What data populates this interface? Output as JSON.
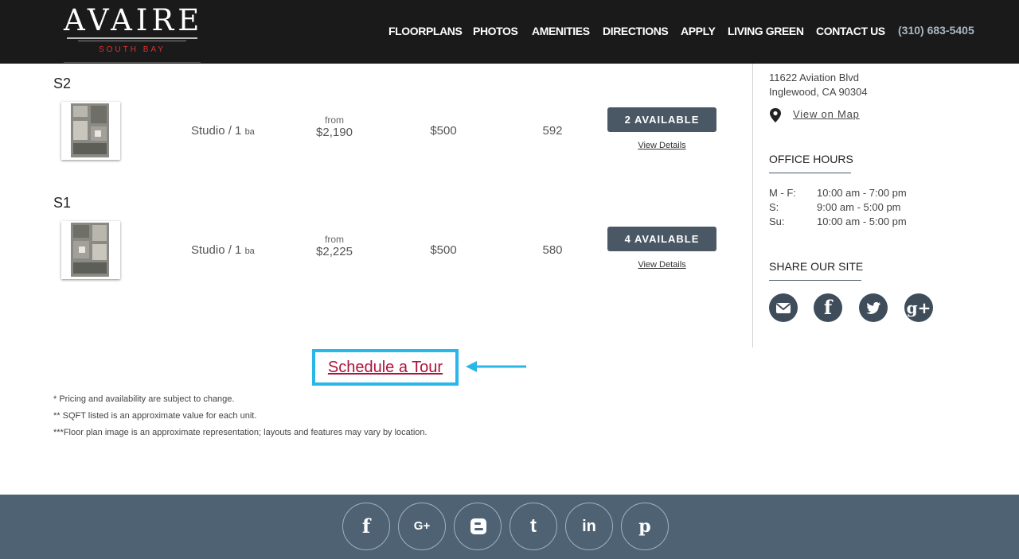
{
  "brand": {
    "name": "AVAIRE",
    "tagline": "SOUTH BAY"
  },
  "nav": {
    "items": [
      {
        "label": "FLOORPLANS"
      },
      {
        "label": "PHOTOS"
      },
      {
        "label": "AMENITIES"
      },
      {
        "label": "DIRECTIONS"
      },
      {
        "label": "APPLY"
      },
      {
        "label": "LIVING GREEN"
      },
      {
        "label": "CONTACT US"
      }
    ],
    "phone": "(310) 683-5405"
  },
  "floorplans": [
    {
      "name": "S2",
      "type_main": "Studio / 1",
      "type_small": "ba",
      "from_label": "from",
      "price": "$2,190",
      "deposit": "$500",
      "sqft": "592",
      "availability": "2 AVAILABLE",
      "details_label": "View Details"
    },
    {
      "name": "S1",
      "type_main": "Studio / 1",
      "type_small": "ba",
      "from_label": "from",
      "price": "$2,225",
      "deposit": "$500",
      "sqft": "580",
      "availability": "4 AVAILABLE",
      "details_label": "View Details"
    }
  ],
  "sidebar": {
    "address_line1": "11622 Aviation Blvd",
    "address_line2": "Inglewood, CA 90304",
    "map_link": "View on Map",
    "office_hours_title": "OFFICE HOURS",
    "hours": [
      {
        "day": "M - F:",
        "time": "10:00 am - 7:00 pm"
      },
      {
        "day": "S:",
        "time": "9:00 am - 5:00 pm"
      },
      {
        "day": "Su:",
        "time": "10:00 am - 5:00 pm"
      }
    ],
    "share_title": "SHARE OUR SITE",
    "share_icons": [
      "email-icon",
      "facebook-icon",
      "twitter-icon",
      "google-plus-icon"
    ]
  },
  "schedule": {
    "label": "Schedule a Tour",
    "highlight_color": "#29b6e8",
    "link_color": "#b0123a"
  },
  "notes": [
    "* Pricing and availability are subject to change.",
    "** SQFT listed is an approximate value for each unit.",
    "***Floor plan image is an approximate representation; layouts and features may vary by location."
  ],
  "footer": {
    "social_icons": [
      "facebook-icon",
      "google-plus-icon",
      "blogger-icon",
      "tumblr-icon",
      "linkedin-icon",
      "pinterest-icon"
    ]
  },
  "colors": {
    "header_bg": "#1a1a1a",
    "button_bg": "#4a5865",
    "footer_bg": "#4e6273",
    "logo_accent": "#e0302e"
  }
}
